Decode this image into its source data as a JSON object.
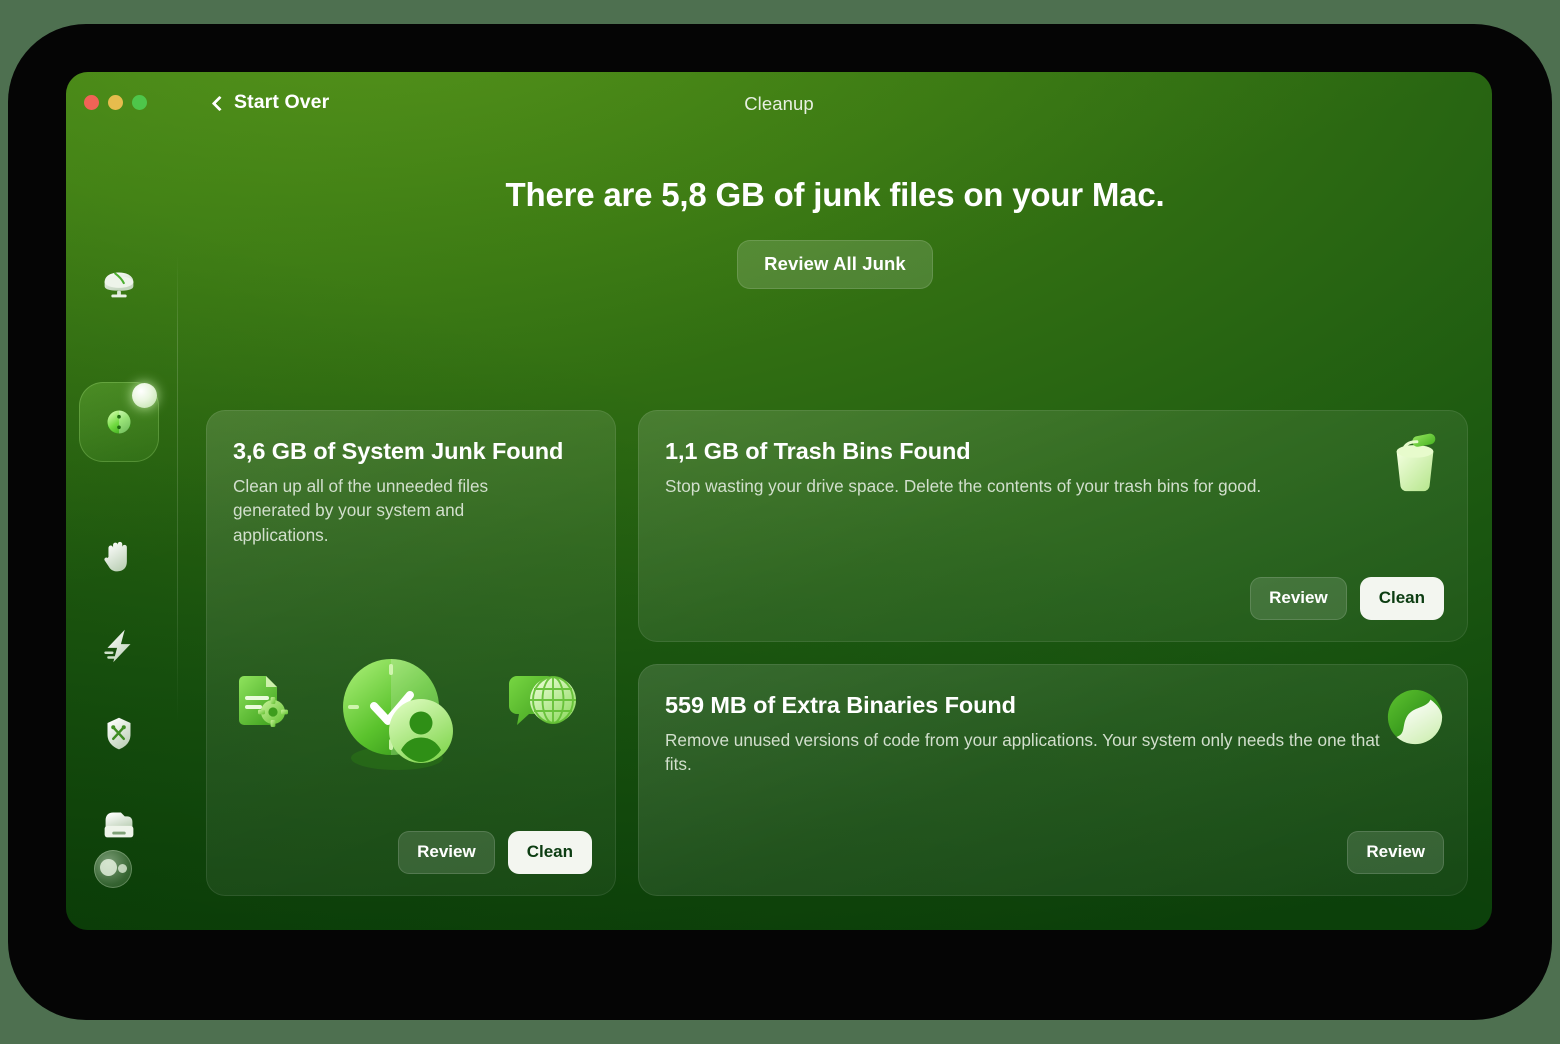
{
  "window": {
    "title": "Cleanup",
    "back_label": "Start Over",
    "traffic_lights": [
      "close",
      "minimize",
      "maximize"
    ]
  },
  "hero": {
    "title": "There are 5,8 GB of junk files on your Mac.",
    "button_label": "Review All Junk"
  },
  "sidebar": {
    "items": [
      {
        "icon": "smart-scan-icon",
        "active": false,
        "badge": false
      },
      {
        "icon": "cleanup-icon",
        "active": true,
        "badge": true
      },
      {
        "icon": "protection-hand-icon",
        "active": false,
        "badge": false
      },
      {
        "icon": "performance-bolt-icon",
        "active": false,
        "badge": false
      },
      {
        "icon": "applications-shield-icon",
        "active": false,
        "badge": false
      },
      {
        "icon": "my-clutter-drawer-icon",
        "active": false,
        "badge": false
      }
    ],
    "avatar": "assistant-avatar-icon"
  },
  "cards": {
    "system_junk": {
      "title": "3,6 GB of System Junk Found",
      "description": "Clean up all of the unneeded files generated by your system and applications.",
      "review_label": "Review",
      "clean_label": "Clean",
      "illustration": [
        "document-gear-icon",
        "clock-user-icon",
        "chat-globe-icon"
      ]
    },
    "trash_bins": {
      "title": "1,1 GB of Trash Bins Found",
      "description": "Stop wasting your drive space. Delete the contents of your trash bins for good.",
      "review_label": "Review",
      "clean_label": "Clean",
      "icon": "trash-bin-icon"
    },
    "extra_binaries": {
      "title": "559 MB of Extra Binaries Found",
      "description": "Remove unused versions of code from your applications. Your system only needs the one that fits.",
      "review_label": "Review",
      "icon": "binaries-sphere-icon"
    }
  },
  "colors": {
    "accent_green": "#5ecb3a",
    "window_top": "#4f8c18",
    "window_bottom": "#0e440c",
    "clean_button_bg": "#f3f6f0",
    "clean_button_text": "#0c3d12",
    "page_bg": "#4e7050",
    "bezel": "#050505"
  }
}
